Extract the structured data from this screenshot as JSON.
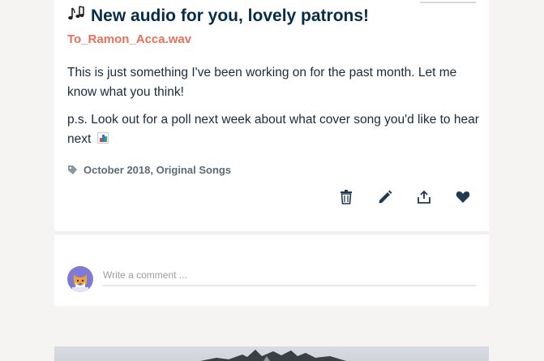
{
  "post": {
    "title": "New audio for you, lovely patrons!",
    "attachment_name": "To_Ramon_Acca.wav",
    "body_1": "This is just something I've been working on for the past month. Let me know what you think!",
    "body_2": "p.s. Look out for a poll next week about what cover song you'd like to hear next",
    "tags": "October 2018, Original Songs"
  },
  "icons": {
    "title_icon": "music-notes-icon",
    "tag_icon": "tag-icon",
    "delete": "trash-icon",
    "edit": "pencil-icon",
    "share": "share-icon",
    "like": "heart-icon",
    "inline_emoji": "bar-chart-icon"
  },
  "comment": {
    "placeholder": "Write a comment ..."
  },
  "colors": {
    "title": "#052d49",
    "attachment": "#e8705a",
    "avatar_bg": "#7e7bd6",
    "icons": "#1f3a52"
  }
}
